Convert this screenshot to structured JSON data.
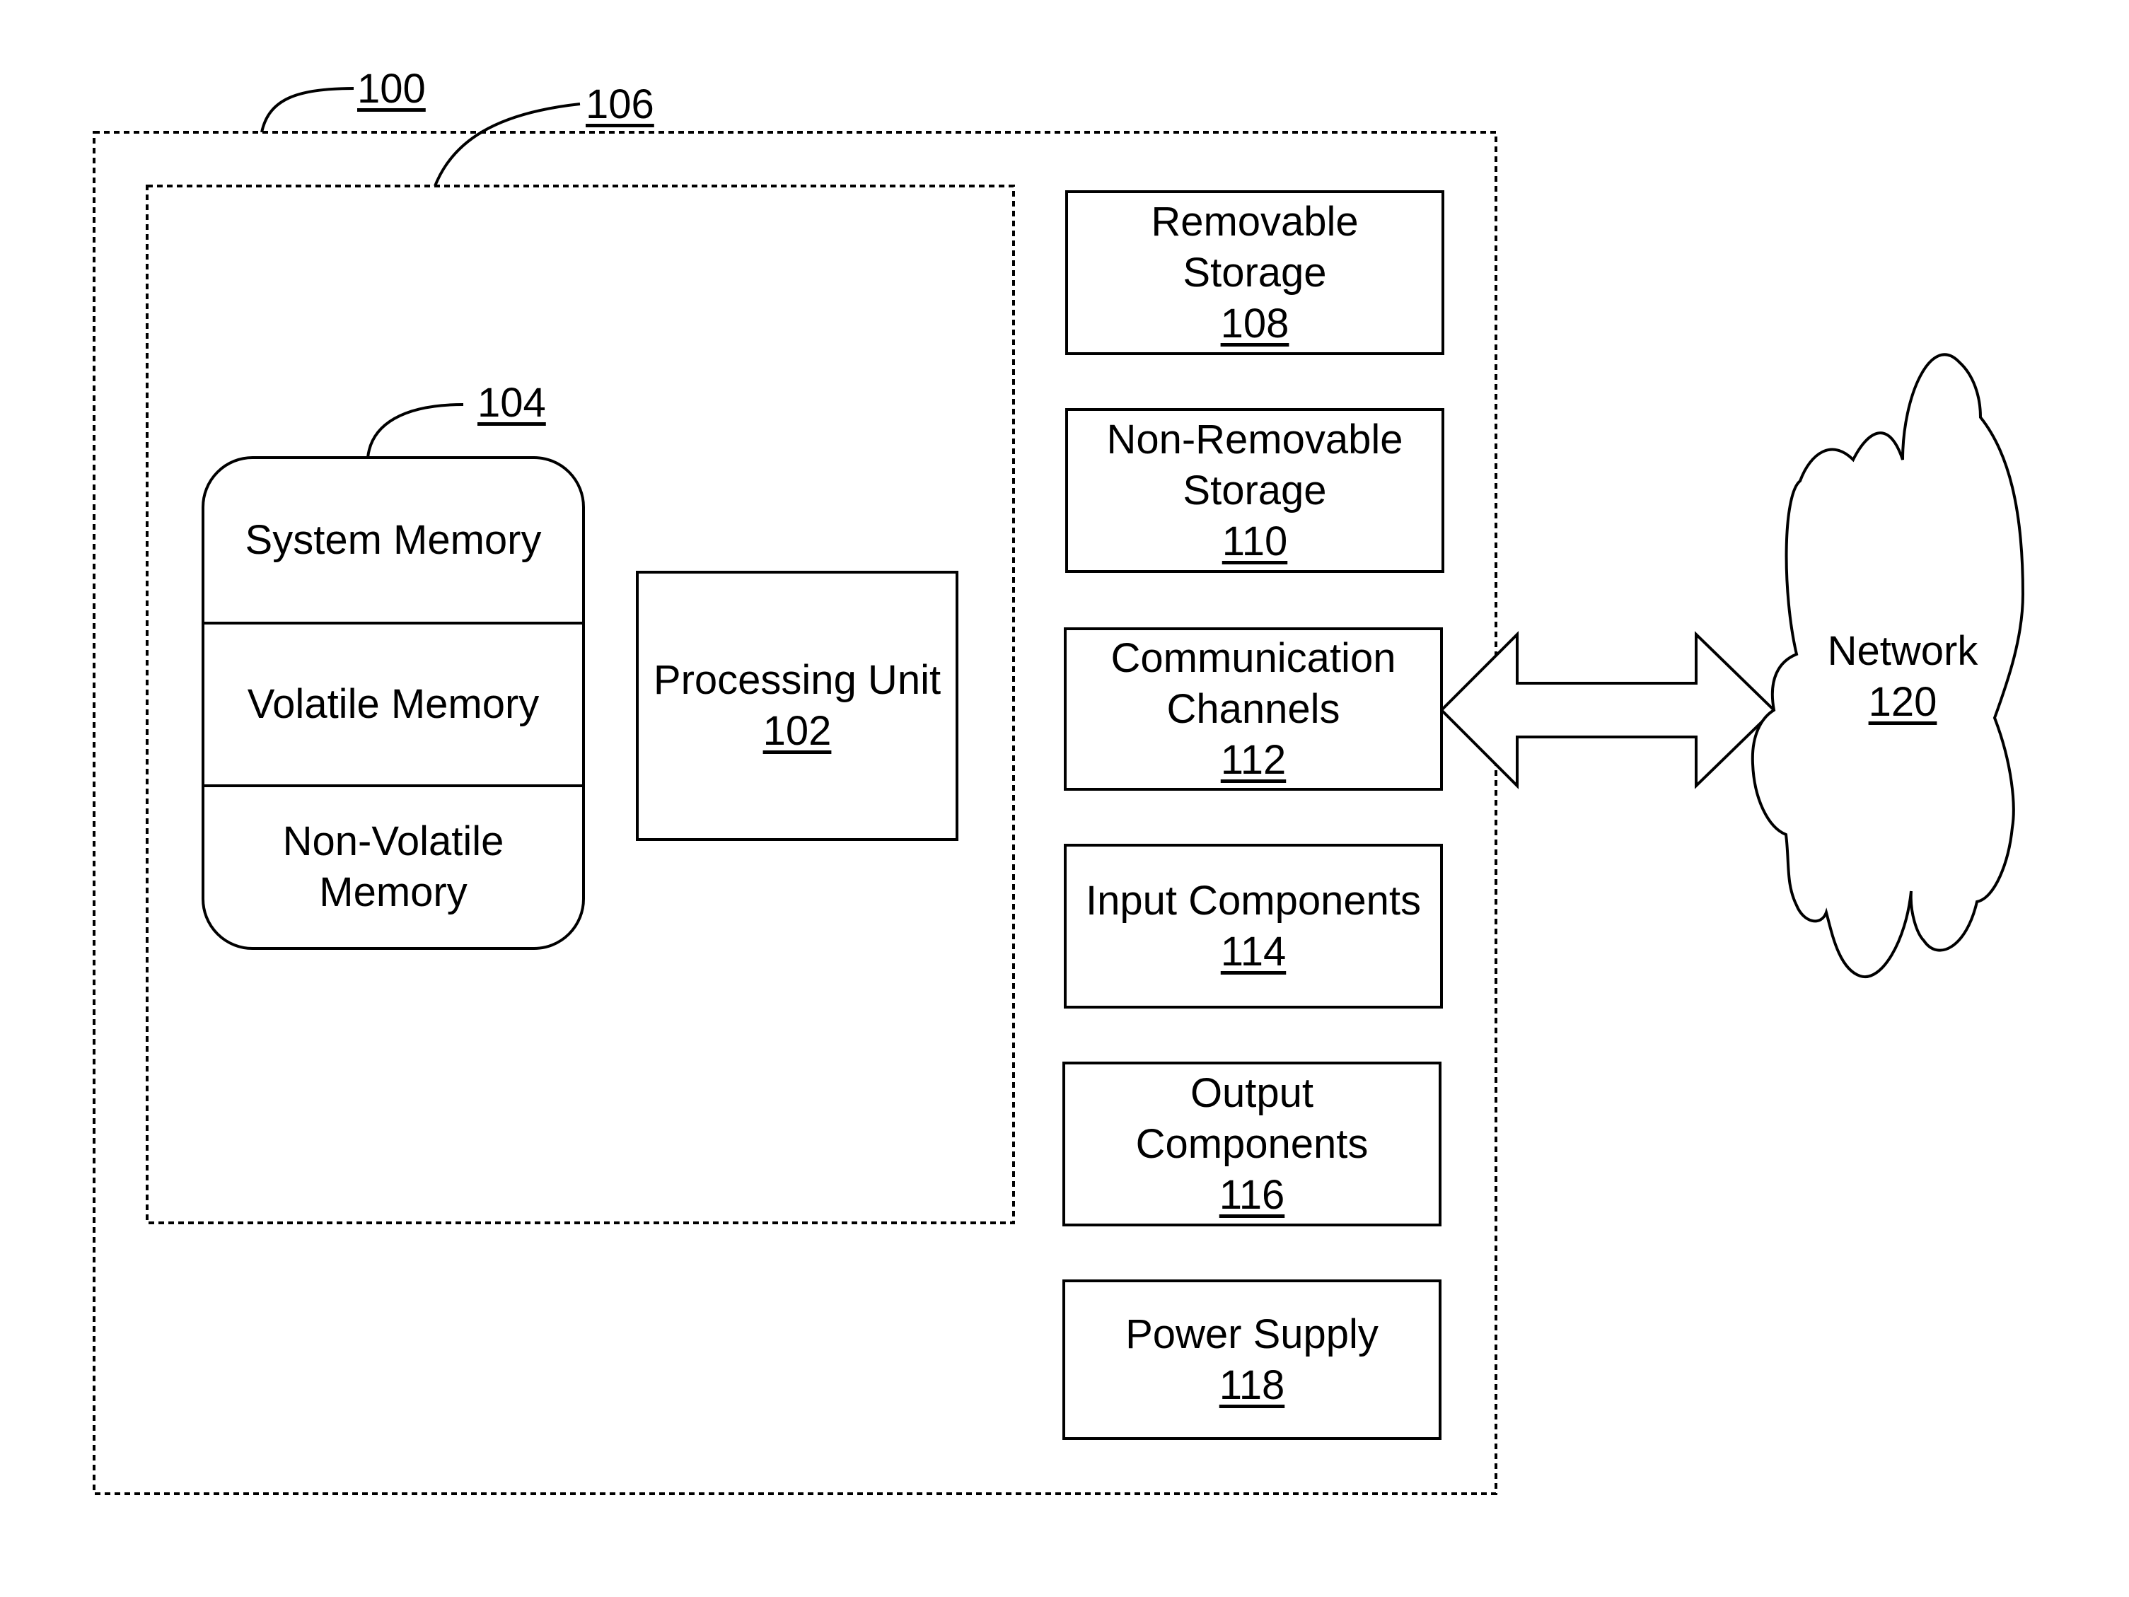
{
  "diagram": {
    "outer_device": {
      "ref": "100"
    },
    "inner_module": {
      "ref": "106"
    },
    "memory": {
      "ref": "104",
      "sections": [
        {
          "label_lines": [
            "System Memory"
          ]
        },
        {
          "label_lines": [
            "Volatile Memory"
          ]
        },
        {
          "label_lines": [
            "Non-Volatile",
            "Memory"
          ]
        }
      ]
    },
    "processing_unit": {
      "label_lines": [
        "Processing Unit"
      ],
      "ref": "102"
    },
    "components": [
      {
        "label_lines": [
          "Removable",
          "Storage"
        ],
        "ref": "108"
      },
      {
        "label_lines": [
          "Non-Removable",
          "Storage"
        ],
        "ref": "110"
      },
      {
        "label_lines": [
          "Communication",
          "Channels"
        ],
        "ref": "112"
      },
      {
        "label_lines": [
          "Input Components"
        ],
        "ref": "114"
      },
      {
        "label_lines": [
          "Output",
          "Components"
        ],
        "ref": "116"
      },
      {
        "label_lines": [
          "Power Supply"
        ],
        "ref": "118"
      }
    ],
    "network": {
      "label": "Network",
      "ref": "120"
    },
    "connection": {
      "type": "bidirectional-arrow",
      "from": "112",
      "to": "120"
    }
  }
}
